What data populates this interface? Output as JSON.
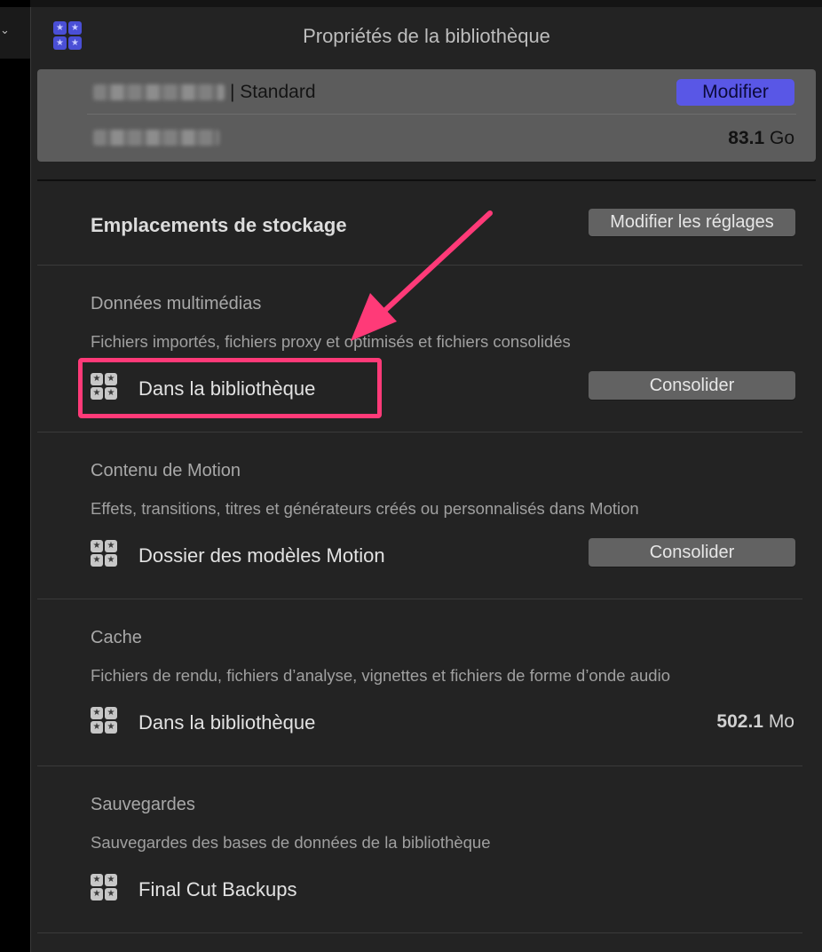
{
  "window": {
    "title": "Propriétés de la bibliothèque"
  },
  "library": {
    "type_text": "| Standard",
    "modify_label": "Modifier",
    "size_value": "83.1",
    "size_unit": "Go"
  },
  "storage": {
    "title": "Emplacements de stockage",
    "modify_settings_label": "Modifier les réglages",
    "sections": [
      {
        "title": "Données multimédias",
        "description": "Fichiers importés, fichiers proxy et optimisés et fichiers consolidés",
        "location": "Dans la bibliothèque",
        "action_label": "Consolider"
      },
      {
        "title": "Contenu de Motion",
        "description": "Effets, transitions, titres et générateurs créés ou personnalisés dans Motion",
        "location": "Dossier des modèles Motion",
        "action_label": "Consolider"
      },
      {
        "title": "Cache",
        "description": "Fichiers de rendu, fichiers d’analyse, vignettes et fichiers de forme d’onde audio",
        "location": "Dans la bibliothèque",
        "size_value": "502.1",
        "size_unit": "Mo"
      },
      {
        "title": "Sauvegardes",
        "description": "Sauvegardes des bases de données de la bibliothèque",
        "location": "Final Cut Backups"
      }
    ]
  },
  "icons": {
    "library": "library-star-icon",
    "arrow": "annotation-arrow",
    "chevron": "chevron-down-icon"
  },
  "colors": {
    "accent": "#5957e6",
    "highlight": "#ff3a78",
    "background": "#232323"
  }
}
